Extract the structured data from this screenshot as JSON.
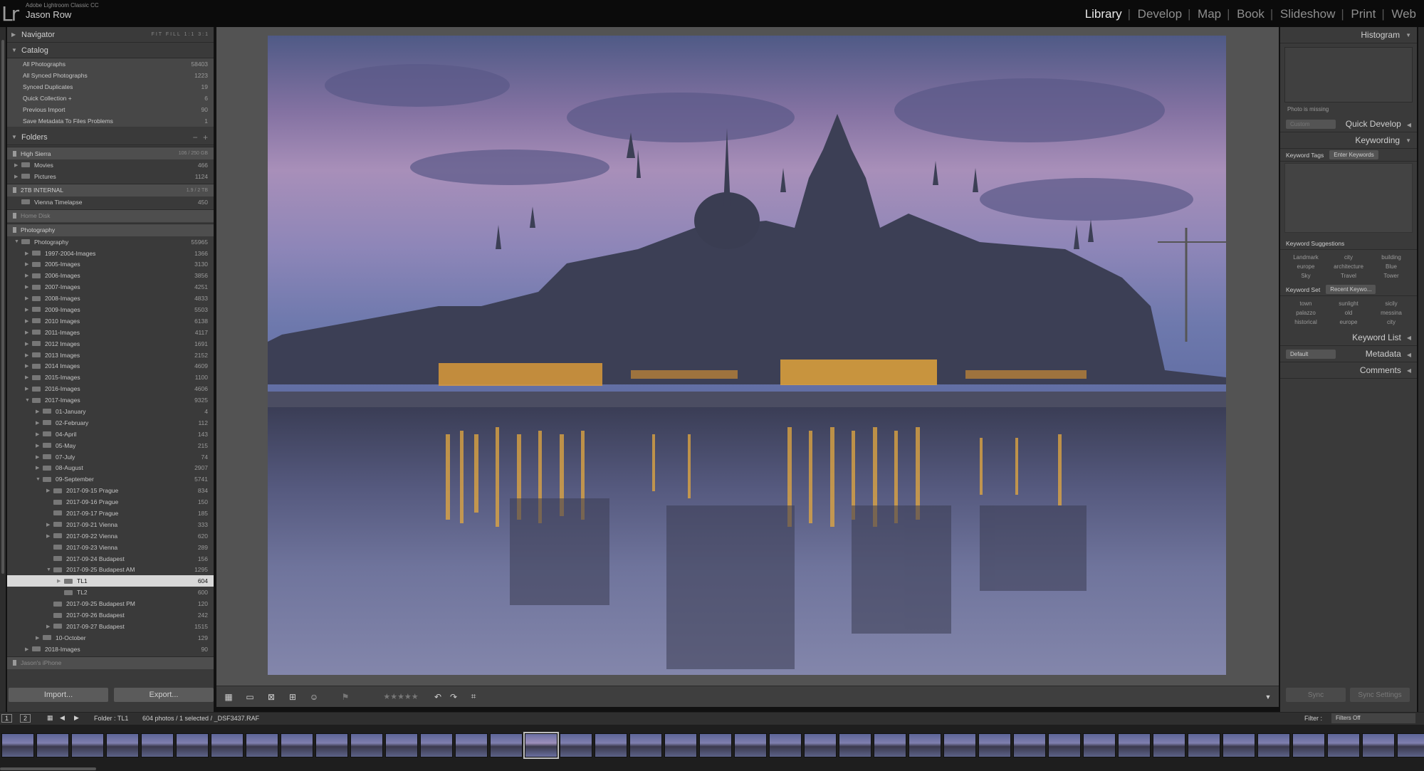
{
  "app": {
    "name": "Adobe Lightroom Classic CC",
    "user": "Jason Row",
    "logo": "Lr"
  },
  "modules": [
    "Library",
    "Develop",
    "Map",
    "Book",
    "Slideshow",
    "Print",
    "Web"
  ],
  "active_module": "Library",
  "navigator": {
    "title": "Navigator",
    "tools": "FIT  FILL  1:1  3:1"
  },
  "catalog": {
    "title": "Catalog",
    "items": [
      {
        "label": "All Photographs",
        "count": "58403"
      },
      {
        "label": "All Synced Photographs",
        "count": "1223"
      },
      {
        "label": "Synced Duplicates",
        "count": "19"
      },
      {
        "label": "Quick Collection +",
        "count": "6"
      },
      {
        "label": "Previous Import",
        "count": "90"
      },
      {
        "label": "Save Metadata To Files Problems",
        "count": "1"
      }
    ]
  },
  "folders": {
    "title": "Folders",
    "volumes": {
      "high_sierra": {
        "label": "High Sierra",
        "info": "106 / 250 GB"
      },
      "internal": {
        "label": "2TB INTERNAL",
        "info": "1.9 / 2 TB"
      },
      "home": {
        "label": "Home Disk"
      },
      "photography": {
        "label": "Photography"
      },
      "iphone": {
        "label": "Jason's iPhone"
      }
    },
    "high_sierra_items": [
      {
        "label": "Movies",
        "count": "466"
      },
      {
        "label": "Pictures",
        "count": "1124"
      }
    ],
    "internal_items": [
      {
        "label": "Vienna Timelapse",
        "count": "450"
      }
    ],
    "tree": [
      {
        "label": "Photography",
        "count": "55965"
      },
      {
        "label": "1997-2004-Images",
        "count": "1366"
      },
      {
        "label": "2005-Images",
        "count": "3130"
      },
      {
        "label": "2006-Images",
        "count": "3856"
      },
      {
        "label": "2007-Images",
        "count": "4251"
      },
      {
        "label": "2008-Images",
        "count": "4833"
      },
      {
        "label": "2009-Images",
        "count": "5503"
      },
      {
        "label": "2010 Images",
        "count": "6138"
      },
      {
        "label": "2011-Images",
        "count": "4117"
      },
      {
        "label": "2012 Images",
        "count": "1691"
      },
      {
        "label": "2013 Images",
        "count": "2152"
      },
      {
        "label": "2014 Images",
        "count": "4609"
      },
      {
        "label": "2015-Images",
        "count": "1100"
      },
      {
        "label": "2016-Images",
        "count": "4606"
      },
      {
        "label": "2017-Images",
        "count": "9325"
      },
      {
        "label": "01-January",
        "count": "4"
      },
      {
        "label": "02-February",
        "count": "112"
      },
      {
        "label": "04-April",
        "count": "143"
      },
      {
        "label": "05-May",
        "count": "215"
      },
      {
        "label": "07-July",
        "count": "74"
      },
      {
        "label": "08-August",
        "count": "2907"
      },
      {
        "label": "09-September",
        "count": "5741"
      },
      {
        "label": "2017-09-15 Prague",
        "count": "834"
      },
      {
        "label": "2017-09-16 Prague",
        "count": "150"
      },
      {
        "label": "2017-09-17 Prague",
        "count": "185"
      },
      {
        "label": "2017-09-21 Vienna",
        "count": "333"
      },
      {
        "label": "2017-09-22 Vienna",
        "count": "620"
      },
      {
        "label": "2017-09-23 Vienna",
        "count": "289"
      },
      {
        "label": "2017-09-24 Budapest",
        "count": "156"
      },
      {
        "label": "2017-09-25 Budapest AM",
        "count": "1295"
      },
      {
        "label": "TL1",
        "count": "604"
      },
      {
        "label": "TL2",
        "count": "600"
      },
      {
        "label": "2017-09-25 Budapest PM",
        "count": "120"
      },
      {
        "label": "2017-09-26 Budapest",
        "count": "242"
      },
      {
        "label": "2017-09-27 Budapest",
        "count": "1515"
      },
      {
        "label": "10-October",
        "count": "129"
      },
      {
        "label": "2018-Images",
        "count": "90"
      }
    ]
  },
  "buttons": {
    "import": "Import...",
    "export": "Export...",
    "sync": "Sync",
    "sync_settings": "Sync Settings"
  },
  "right_panel": {
    "histogram": "Histogram",
    "photo_missing": "Photo is missing",
    "quick_develop": "Quick Develop",
    "quick_develop_preset": "Custom",
    "keywording": "Keywording",
    "keyword_tags": "Keyword Tags",
    "enter_keywords": "Enter Keywords",
    "keyword_suggestions": "Keyword Suggestions",
    "suggestions": [
      "Landmark",
      "city",
      "building",
      "europe",
      "architecture",
      "Blue",
      "Sky",
      "Travel",
      "Tower"
    ],
    "keyword_set": "Keyword Set",
    "keyword_set_value": "Recent Keywo...",
    "set_keywords": [
      "town",
      "sunlight",
      "sicily",
      "palazzo",
      "old",
      "messina",
      "historical",
      "europe",
      "city"
    ],
    "keyword_list": "Keyword List",
    "metadata": "Metadata",
    "metadata_preset": "Default",
    "comments": "Comments"
  },
  "filmstrip": {
    "page1": "1",
    "page2": "2",
    "folder": "Folder : TL1",
    "info": "604 photos / 1 selected / _DSF3437.RAF",
    "filter_label": "Filter :",
    "filter_value": "Filters Off"
  }
}
